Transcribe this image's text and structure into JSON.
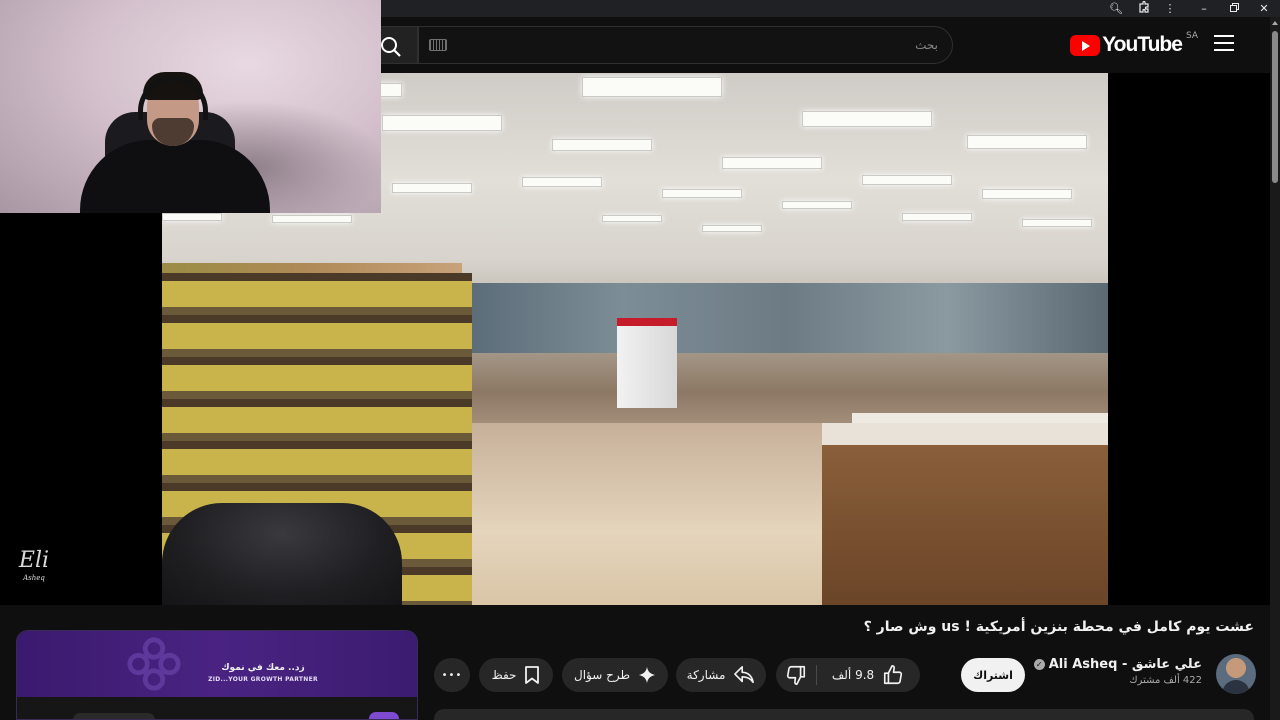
{
  "browser": {
    "icons": [
      "zoom-icon",
      "extensions-icon",
      "kebab-menu-icon",
      "minimize-icon",
      "restore-icon",
      "close-icon"
    ]
  },
  "header": {
    "logo_text": "YouTube",
    "country_code": "SA",
    "search_placeholder": "بحث"
  },
  "watermark": {
    "main": "Eli",
    "sub": "Asheq"
  },
  "video": {
    "title": "عشت يوم كامل في محطة بنزين أمريكية ! us وش صار ؟",
    "channel_name": "علي عاشق - Ali Asheq",
    "subscribers": "422 ألف مشترك",
    "subscribe_label": "اشتراك",
    "likes": "9.8 ألف",
    "share_label": "مشاركة",
    "ask_label": "طرح سؤال",
    "save_label": "حفظ",
    "more_label": "•••"
  },
  "ad": {
    "line1": "زد.. معك في نموك",
    "line2": "ZID...YOUR GROWTH PARTNER"
  },
  "colors": {
    "brand_red": "#ff0000",
    "background": "#0f0f0f",
    "pill": "#272727",
    "ad_purple": "#4a2382"
  }
}
